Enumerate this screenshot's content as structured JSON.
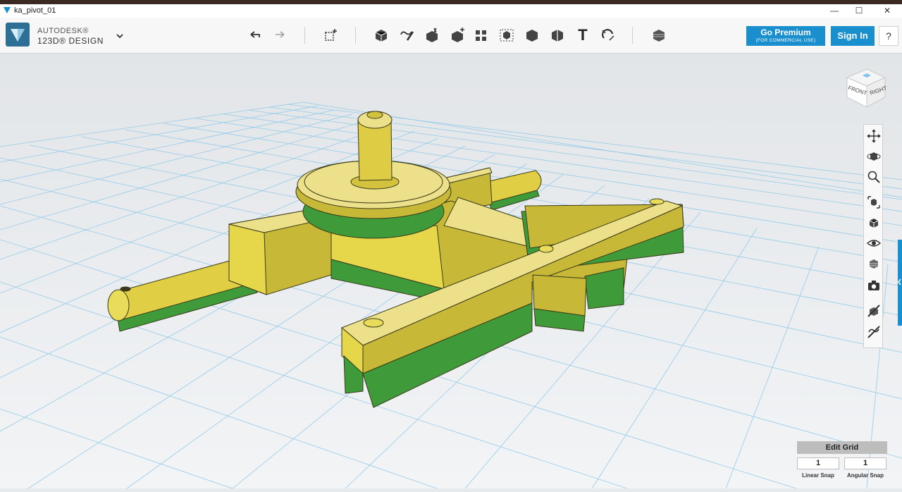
{
  "window": {
    "title": "ka_pivot_01",
    "minimize_glyph": "—",
    "maximize_glyph": "☐",
    "close_glyph": "✕"
  },
  "brand": {
    "line1": "AUTODESK®",
    "line2": "123D® DESIGN",
    "logo_icon": "autodesk-logo-icon"
  },
  "toolbar": {
    "undo_icon": "undo-icon",
    "redo_icon": "redo-icon",
    "tools": [
      "transform-icon",
      "primitives-icon",
      "sketch-icon",
      "construct-icon",
      "modify-icon",
      "pattern-icon",
      "grouping-icon",
      "combine-icon",
      "measure-icon",
      "text-icon",
      "snap-icon",
      "material-icon"
    ],
    "text_tool_glyph": "T"
  },
  "actions": {
    "premium_label": "Go Premium",
    "premium_sub": "(FOR COMMERCIAL USE)",
    "signin_label": "Sign In",
    "help_label": "?"
  },
  "viewcube": {
    "front": "FRONT",
    "right": "RIGHT"
  },
  "nav": [
    "pan-icon",
    "orbit-icon",
    "zoom-icon",
    "fit-icon",
    "view-icon",
    "visibility-icon",
    "material-view-icon",
    "screenshot-icon",
    "hide-icon",
    "sketch-visibility-icon"
  ],
  "colors": {
    "accent": "#1a8fce",
    "part_yellow": "#e6d64a",
    "part_green": "#3f9a3a",
    "grid": "#8ec9e8"
  },
  "grid_panel": {
    "edit_grid_label": "Edit Grid",
    "linear_snap_value": "1",
    "angular_snap_value": "1",
    "linear_snap_label": "Linear Snap",
    "angular_snap_label": "Angular Snap"
  }
}
